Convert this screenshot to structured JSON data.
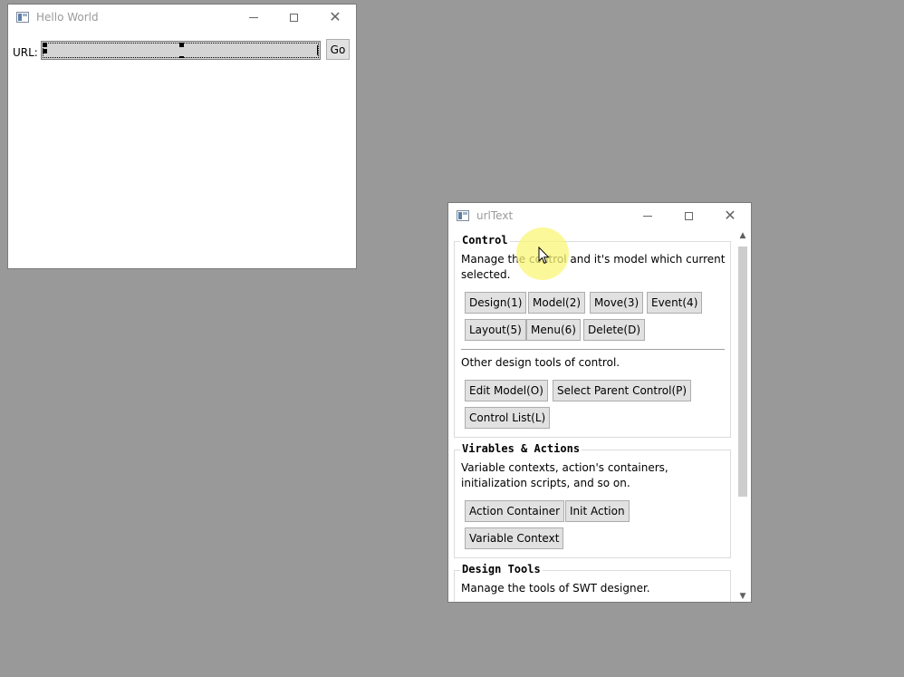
{
  "hello_window": {
    "title": "Hello World",
    "url_label": "URL:",
    "url_value": "",
    "go_label": "Go"
  },
  "designer_window": {
    "title": "urlText",
    "control_group": {
      "title": "Control",
      "description": "Manage the control and it's model which current selected.",
      "buttons": {
        "design": "Design(1)",
        "model": "Model(2)",
        "move": "Move(3)",
        "event": "Event(4)",
        "layout": "Layout(5)",
        "menu": "Menu(6)",
        "delete": "Delete(D)"
      },
      "other_description": "Other design tools of control.",
      "other_buttons": {
        "edit_model": "Edit Model(O)",
        "select_parent": "Select Parent Control(P)",
        "control_list": "Control List(L)"
      }
    },
    "variables_group": {
      "title": "Virables & Actions",
      "description": "Variable contexts, action's containers, initialization scripts, and so on.",
      "buttons": {
        "action_container": "Action Container",
        "init_action": "Init Action",
        "variable_context": "Variable Context"
      }
    },
    "design_tools_group": {
      "title": "Design Tools",
      "description": "Manage the tools of SWT designer."
    }
  },
  "colors": {
    "desktop": "#999999",
    "button_face": "#e1e1e1",
    "cursor_highlight": "#faf578"
  }
}
